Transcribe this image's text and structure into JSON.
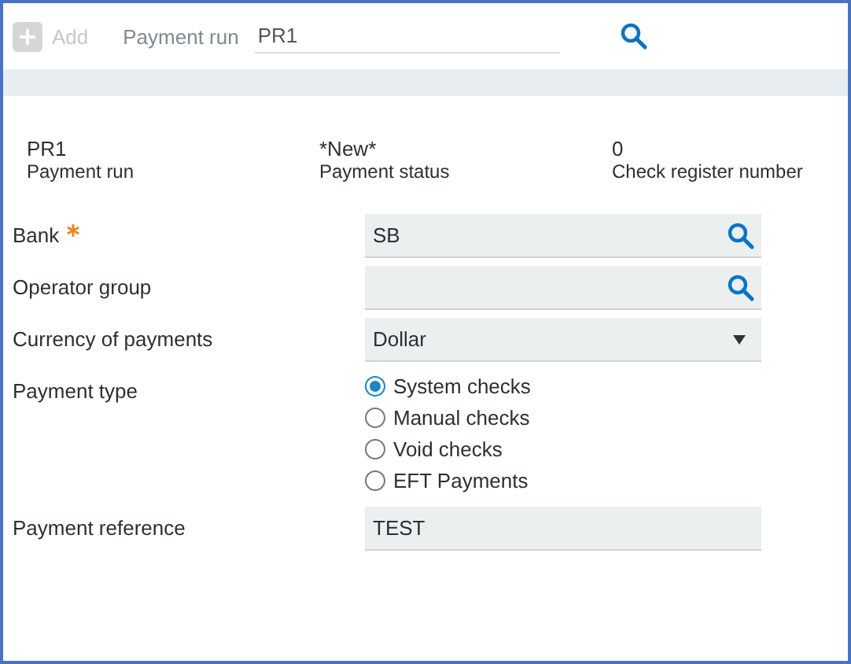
{
  "toolbar": {
    "add_button": {
      "label": "Add",
      "disabled": true
    },
    "payment_run": {
      "label": "Payment run",
      "value": "PR1"
    }
  },
  "summary": [
    {
      "value": "PR1",
      "label": "Payment run"
    },
    {
      "value": "*New*",
      "label": "Payment status"
    },
    {
      "value": "0",
      "label": "Check register number"
    }
  ],
  "fields": [
    {
      "label": "Bank",
      "required": true,
      "kind": "lookup",
      "value": "SB"
    },
    {
      "label": "Operator group",
      "required": false,
      "kind": "lookup"
    },
    {
      "label": "Currency of payments",
      "required": false,
      "kind": "select",
      "value": "Dollar"
    },
    {
      "label": "Payment type",
      "required": false,
      "kind": "radio",
      "options": [
        {
          "label": "System checks",
          "selected": true
        },
        {
          "label": "Manual checks",
          "selected": false
        },
        {
          "label": "Void checks",
          "selected": false
        },
        {
          "label": "EFT Payments",
          "selected": false
        }
      ]
    },
    {
      "label": "Payment reference",
      "required": false,
      "kind": "text",
      "value": "TEST"
    }
  ]
}
